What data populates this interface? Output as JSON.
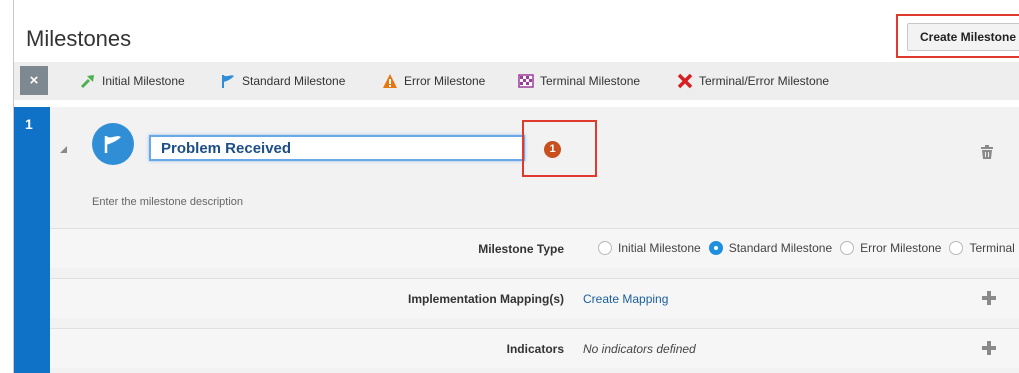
{
  "header": {
    "title": "Milestones",
    "create_button": "Create Milestone"
  },
  "toolbar": {
    "close_symbol": "×",
    "legend": [
      {
        "label": "Initial Milestone",
        "icon": "initial-milestone-icon"
      },
      {
        "label": "Standard Milestone",
        "icon": "standard-milestone-icon"
      },
      {
        "label": "Error Milestone",
        "icon": "error-milestone-icon"
      },
      {
        "label": "Terminal Milestone",
        "icon": "terminal-milestone-icon"
      },
      {
        "label": "Terminal/Error Milestone",
        "icon": "terminal-error-milestone-icon"
      }
    ]
  },
  "milestone": {
    "number": "1",
    "name": "Problem Received",
    "badge_count": "1",
    "description_placeholder": "Enter the milestone description",
    "type_label": "Milestone Type",
    "type_options": [
      "Initial Milestone",
      "Standard Milestone",
      "Error Milestone",
      "Terminal M"
    ],
    "type_selected": "Standard Milestone",
    "mapping_label": "Implementation Mapping(s)",
    "mapping_link": "Create Mapping",
    "indicators_label": "Indicators",
    "indicators_value": "No indicators defined"
  },
  "colors": {
    "accent": "#0f72c6",
    "highlight": "#e03a2e",
    "badge": "#c8501d"
  }
}
